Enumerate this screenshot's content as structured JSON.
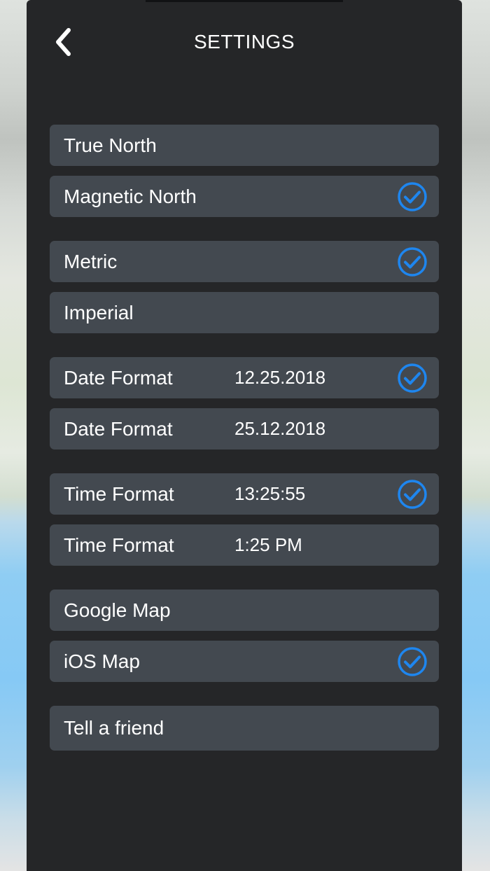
{
  "header": {
    "title": "SETTINGS",
    "back_icon": "chevron-left-icon"
  },
  "colors": {
    "panel": "#252628",
    "row": "#434950",
    "text": "#ffffff",
    "accent": "#1e86ef"
  },
  "rows": [
    {
      "id": "true-north",
      "label": "True North",
      "value": "",
      "checked": false
    },
    {
      "id": "magnetic-north",
      "label": "Magnetic North",
      "value": "",
      "checked": true
    },
    {
      "id": "metric",
      "label": "Metric",
      "value": "",
      "checked": true
    },
    {
      "id": "imperial",
      "label": "Imperial",
      "value": "",
      "checked": false
    },
    {
      "id": "date-format-us",
      "label": "Date Format",
      "value": "12.25.2018",
      "checked": true
    },
    {
      "id": "date-format-eu",
      "label": "Date Format",
      "value": "25.12.2018",
      "checked": false
    },
    {
      "id": "time-format-24h",
      "label": "Time Format",
      "value": "13:25:55",
      "checked": true
    },
    {
      "id": "time-format-12h",
      "label": "Time Format",
      "value": "1:25 PM",
      "checked": false
    },
    {
      "id": "google-map",
      "label": "Google Map",
      "value": "",
      "checked": false
    },
    {
      "id": "ios-map",
      "label": "iOS Map",
      "value": "",
      "checked": true
    },
    {
      "id": "tell-a-friend",
      "label": "Tell a friend",
      "value": "",
      "checked": false
    }
  ]
}
